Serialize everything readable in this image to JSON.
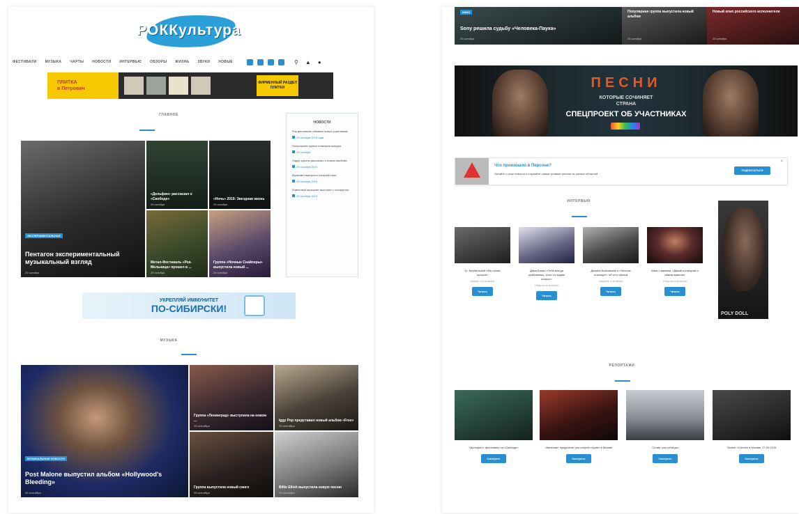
{
  "left": {
    "logo": "РОККультура",
    "nav": [
      "ФЕСТИВАЛИ",
      "МУЗЫКА",
      "ЧАРТЫ",
      "НОВОСТИ",
      "ИНТЕРВЬЮ",
      "ОБЗОРЫ",
      "ЖИЗНЬ",
      "ЗВУКИ",
      "НОВЫЕ"
    ],
    "social_icons": [
      "vk-icon",
      "ok-icon",
      "instagram-icon",
      "location-icon"
    ],
    "tools": [
      "search-icon",
      "user-icon",
      "menu-icon"
    ],
    "banner_tiles": {
      "line1": "ПЛИТКА",
      "line2": "в Петрович",
      "right": "ФИРМЕННЫЙ РАЗДЕЛ ПЛИТКИ"
    },
    "section_main": "ГЛАВНОЕ",
    "tiles": [
      {
        "caption": "Пентагон экспериментальный музыкальный взгляд",
        "badge": "ЭКСПЕРИМЕНТАЛЬНАЯ",
        "date": "29 октября"
      },
      {
        "caption": "«Дельфин» рассказал о «Свободе»",
        "date": "29 октября"
      },
      {
        "caption": "«Ночь» 2019: Звездная жизнь",
        "date": "29 октября"
      },
      {
        "caption": "Метал-Фестиваль «Рок-Мельница» прошел в ...",
        "date": "29 октября"
      },
      {
        "caption": "Группа «Ночные Снайперы» выпустила новый ...",
        "date": "29 октября"
      }
    ],
    "sidebar": {
      "title": "НОВОСТИ",
      "entries": [
        {
          "title": "Рок-фестиваль объявил новых участников",
          "date": "29 октября 2019 года"
        },
        {
          "title": "Популярная группа отменила концерт",
          "date": "29 октября"
        },
        {
          "title": "Лидер группы рассказал о новом альбоме",
          "date": "29 октября 2019"
        },
        {
          "title": "Музыкант выпустил сольный клип",
          "date": "29 октября 2019"
        },
        {
          "title": "Известный музыкант выступит с концертом",
          "date": "29 октября 2019"
        }
      ]
    },
    "banner_sib": {
      "line1": "УКРЕПЛЯЙ ИММУНИТЕТ",
      "line2": "ПО-СИБИРСКИ!"
    },
    "section_music": "МУЗЫКА",
    "music_tiles": [
      {
        "caption": "Post Malone выпустил альбом «Hollywood's Bleeding»",
        "badge": "МУЗЫКАЛЬНЫЕ НОВОСТИ",
        "date": "25 сентября"
      },
      {
        "caption": "Группа «Ленинград» выступила на новом ...",
        "date": "25 сентября"
      },
      {
        "caption": "Iggy Pop представил новый альбом «Free»",
        "date": "25 сентября"
      },
      {
        "caption": "Группа выпустила новый сингл",
        "date": "25 сентября"
      },
      {
        "caption": "Billie Eilish выпустила новую песню",
        "date": "25 сентября"
      }
    ]
  },
  "right": {
    "strip": [
      {
        "caption": "Sony решила судьбу «Человека-Паука»",
        "badge": "КИНО",
        "date": "25 октября"
      },
      {
        "caption": "Популярная группа выпустила новый альбом",
        "date": "25 октября"
      },
      {
        "caption": "Новый клип российского исполнителя",
        "date": "25 октября"
      }
    ],
    "pesni": {
      "title": "ПЕСНИ",
      "sub1": "КОТОРЫЕ СОЧИНЯЕТ",
      "sub2": "СТРАНА",
      "tagline": "СПЕЦПРОЕКТ ОБ УЧАСТНИКАХ"
    },
    "notification": {
      "title": "Что произошло в Персоне?",
      "text": "Читайте о роке новости и слушайте самые громкие релизы из разных областей",
      "button": "ПОДПИСАТЬСЯ",
      "close": "×"
    },
    "section_interview": "ИНТЕРВЬЮ",
    "interview_cards": [
      {
        "title": "Гр. Вербальный «Мы снова лучшие»",
        "date": "Вчера, 14 октября",
        "button": "Читать"
      },
      {
        "title": "Дима Билан «Тебе всегда разбиваешь, если ты задаю вопрос»",
        "date": "Неделю 8 октября",
        "button": "Читать"
      },
      {
        "title": "Данила Козловский о «Лесном сталкере»: об этот фильм",
        "date": "Неделю 3 октября",
        "button": "Читать"
      },
      {
        "title": "Анна о важном: «Давай поговорим о самом важном»",
        "date": "Неделю 6 октября",
        "button": "Читать"
      }
    ],
    "side_ad": "POLY DOLL",
    "section_reports": "РЕПОРТАЖИ",
    "report_cards": [
      {
        "title": "«Дельфин»: фестиваль на «Свободе»",
        "button": "Смотреть"
      },
      {
        "title": "«Кипелов» предстанет рок-оперой «Ария» в Москве",
        "button": "Смотреть"
      },
      {
        "title": "Сплин: рок-легенды",
        "button": "Смотреть"
      },
      {
        "title": "Проект «Сплин» в Москве, 27.09.2019",
        "button": "Смотреть"
      }
    ]
  }
}
